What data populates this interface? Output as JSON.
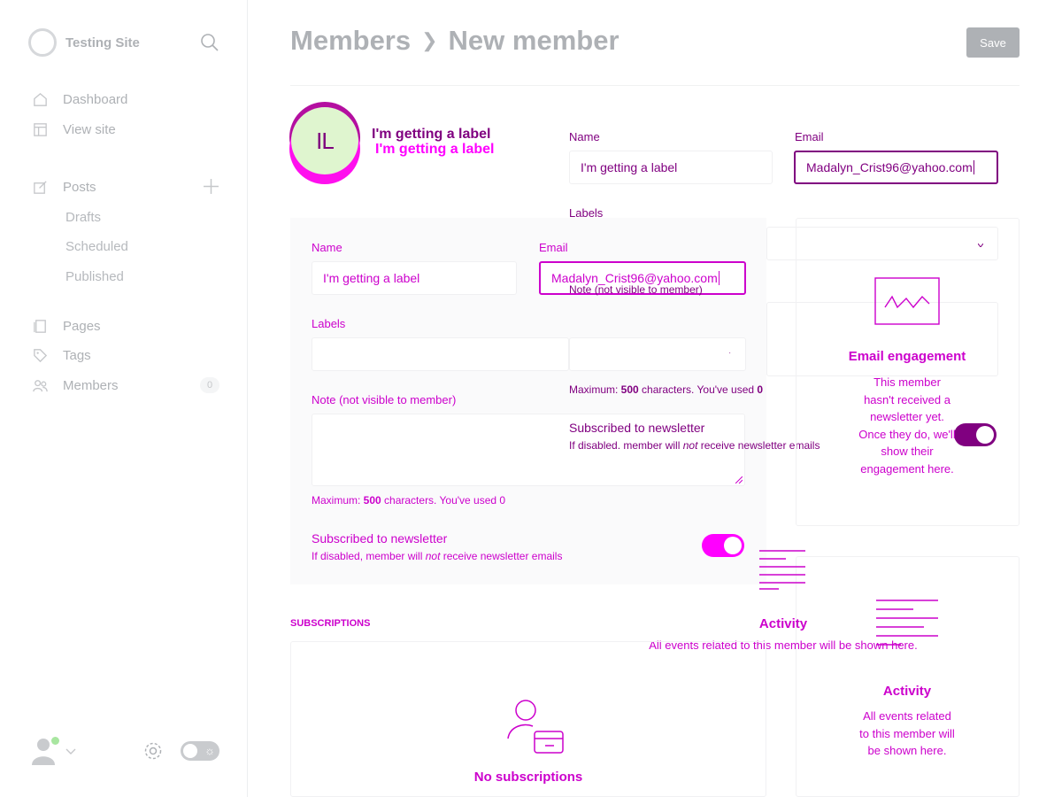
{
  "sidebar": {
    "site_name": "Testing Site",
    "nav": [
      {
        "label": "Dashboard",
        "icon": "home-icon"
      },
      {
        "label": "View site",
        "icon": "layout-icon"
      },
      {
        "label": "Posts",
        "icon": "edit-icon"
      },
      {
        "label": "Pages",
        "icon": "pages-icon"
      },
      {
        "label": "Tags",
        "icon": "tag-icon"
      },
      {
        "label": "Members",
        "icon": "members-icon"
      }
    ],
    "posts_sub": [
      "Drafts",
      "Scheduled",
      "Published"
    ],
    "members_count": "0"
  },
  "header": {
    "crumb_parent": "Members",
    "crumb_current": "New member",
    "save_label": "Save"
  },
  "member": {
    "initials": "IL",
    "display_name": "I'm getting a label",
    "name_value": "I'm getting a label",
    "email_value": "Madalyn_Crist96@yahoo.com"
  },
  "form": {
    "name_label": "Name",
    "email_label": "Email",
    "labels_label": "Labels",
    "note_label": "Note",
    "note_hint": "(not visible to member)",
    "note_max_prefix": "Maximum: ",
    "note_max_value": "500",
    "note_max_middle": " characters. You've used ",
    "note_used": "0",
    "newsletter_title": "Subscribed to newsletter",
    "newsletter_desc_prefix": "If disabled, member will ",
    "newsletter_desc_em": "not",
    "newsletter_desc_suffix": " receive newsletter emails",
    "newsletter_on": true
  },
  "ghost_form": {
    "newsletter_desc_prefix": "If disabled. member will "
  },
  "subscriptions": {
    "heading": "SUBSCRIPTIONS",
    "empty_title": "No subscriptions"
  },
  "engagement": {
    "title": "Email engagement",
    "text_lines": [
      "This member",
      "hasn't received a",
      "newsletter yet.",
      "Once they do, we'll",
      "show their",
      "engagement here."
    ]
  },
  "activity": {
    "title": "Activity",
    "text_lines": [
      "All events related",
      "to this member will",
      "be shown here."
    ],
    "overlay_title": "Activity",
    "overlay_text": "All events related to this member will be shown here."
  },
  "colors": {
    "magenta": "#ff00ff",
    "purple": "#800080",
    "deep_magenta": "#cc00cc",
    "muted": "#aeb1b5"
  }
}
